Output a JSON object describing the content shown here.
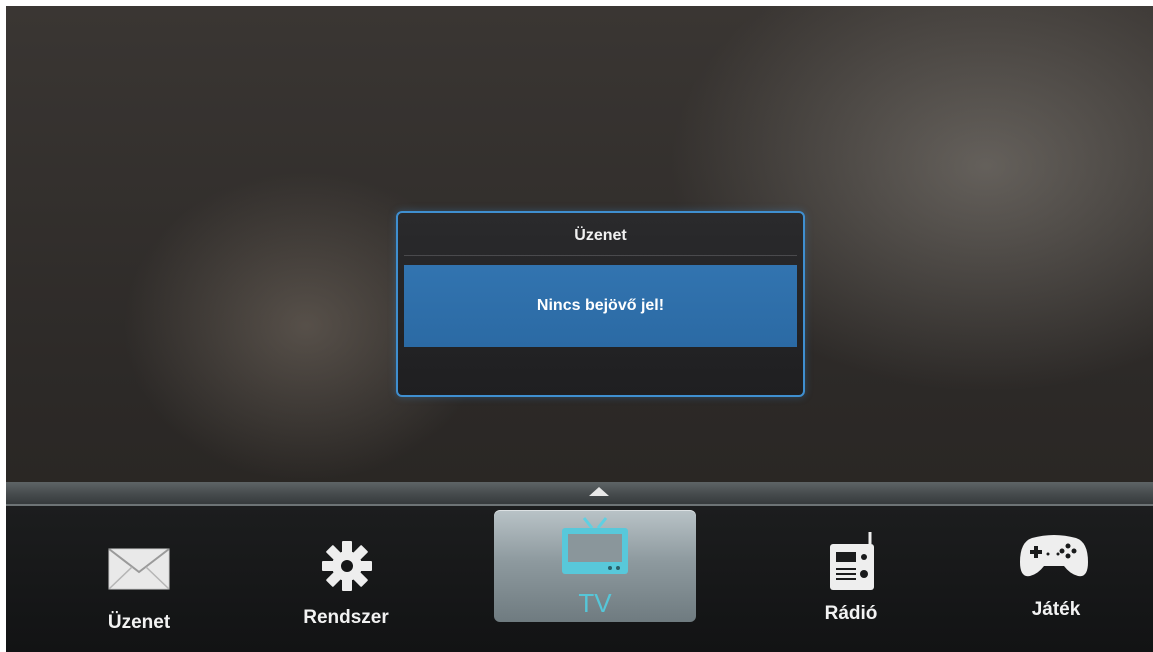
{
  "dialog": {
    "title": "Üzenet",
    "message": "Nincs bejövő jel!"
  },
  "menu": {
    "items": [
      {
        "label": "Üzenet",
        "icon": "envelope-icon"
      },
      {
        "label": "Rendszer",
        "icon": "gear-icon"
      },
      {
        "label": "TV",
        "icon": "tv-icon",
        "selected": true
      },
      {
        "label": "Rádió",
        "icon": "radio-icon"
      },
      {
        "label": "Játék",
        "icon": "gamepad-icon"
      }
    ]
  },
  "colors": {
    "accent": "#3f8fd0",
    "message_bg": "#2f70ab",
    "selected_label": "#56c6d8"
  }
}
